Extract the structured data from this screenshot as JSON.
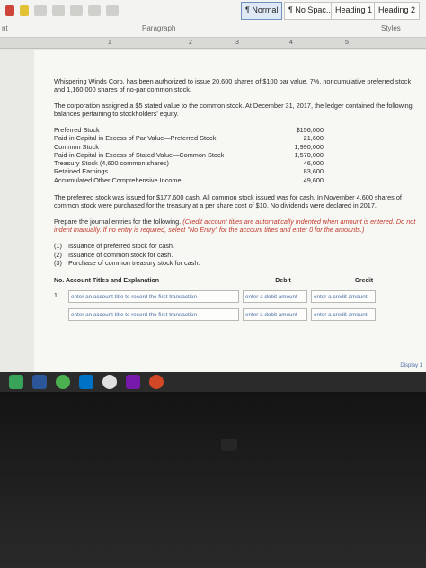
{
  "ribbon": {
    "styles": [
      "¶ Normal",
      "¶ No Spac...",
      "Heading 1",
      "Heading 2"
    ],
    "group_paragraph": "Paragraph",
    "group_styles": "Styles",
    "partial_left_text": "nt"
  },
  "ruler": {
    "ticks": [
      "1",
      "2",
      "3",
      "4",
      "5"
    ]
  },
  "document": {
    "intro": "Whispering Winds Corp. has been authorized to issue 20,600 shares of $100 par value, 7%, noncumulative preferred stock and 1,160,000 shares of no-par common stock.",
    "stated_value": "The corporation assigned a $5 stated value to the common stock. At December 31, 2017, the ledger contained the following balances pertaining to stockholders' equity.",
    "balances": [
      {
        "account": "Preferred Stock",
        "amount": "$156,000"
      },
      {
        "account": "Paid-in Capital in Excess of Par Value—Preferred Stock",
        "amount": "21,600"
      },
      {
        "account": "Common Stock",
        "amount": "1,990,000"
      },
      {
        "account": "Paid-in Capital in Excess of Stated Value—Common Stock",
        "amount": "1,570,000"
      },
      {
        "account": "Treasury Stock (4,600 common shares)",
        "amount": "46,000"
      },
      {
        "account": "Retained Earnings",
        "amount": "83,600"
      },
      {
        "account": "Accumulated Other Comprehensive Income",
        "amount": "49,600"
      }
    ],
    "issue_text": "The preferred stock was issued for $177,600 cash. All common stock issued was for cash. In November 4,600 shares of common stock were purchased for the treasury at a per share cost of $10. No dividends were declared in 2017.",
    "instruction_lead": "Prepare the journal entries for the following.",
    "instruction_red": "(Credit account titles are automatically indented when amount is entered. Do not indent manually. If no entry is required, select \"No Entry\" for the account titles and enter 0 for the amounts.)",
    "tasks": [
      {
        "num": "(1)",
        "text": "Issuance of preferred stock for cash."
      },
      {
        "num": "(2)",
        "text": "Issuance of common stock for cash."
      },
      {
        "num": "(3)",
        "text": "Purchase of common treasury stock for cash."
      }
    ],
    "journal": {
      "col_no": "No.",
      "col_account": "Account Titles and Explanation",
      "col_debit": "Debit",
      "col_credit": "Credit",
      "row_no": "1.",
      "acct_placeholder": "enter an account title to record the first transaction",
      "debit_placeholder": "enter a debit amount",
      "credit_placeholder": "enter a credit amount"
    },
    "display_button": "Display 1"
  }
}
